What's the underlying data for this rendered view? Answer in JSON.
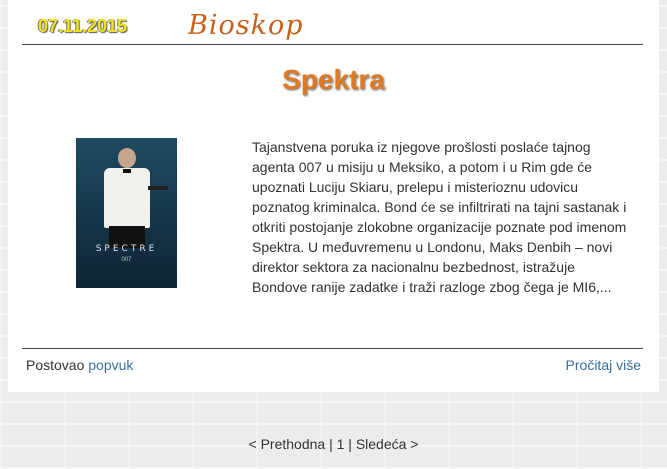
{
  "post": {
    "date": "07.11.2015",
    "category": "Bioskop",
    "title": "Spektra",
    "poster": {
      "title": "SPECTRE",
      "subtitle": "007"
    },
    "description": "Tajanstvena poruka iz njegove prošlosti poslaće tajnog agenta 007 u misiju u Meksiko, a potom i u Rim gde će upoznati Luciju Skiaru, prelepu i misterioznu udovicu poznatog kriminalca. Bond će se infiltrirati na tajni sastanak i otkriti postojanje zlokobne organizacije poznate pod imenom Spektra. U međuvremenu u Londonu, Maks Denbih – novi direktor sektora za nacionalnu bezbednost, istražuje Bondove ranije zadatke i traži razloge zbog čega je MI6,...",
    "posted_by_label": "Postovao",
    "author": "popvuk",
    "read_more": "Pročitaj više"
  },
  "pagination": {
    "prev": "< Prethodna",
    "sep1": "|",
    "current": "1",
    "sep2": "|",
    "next": "Sledeća >"
  }
}
